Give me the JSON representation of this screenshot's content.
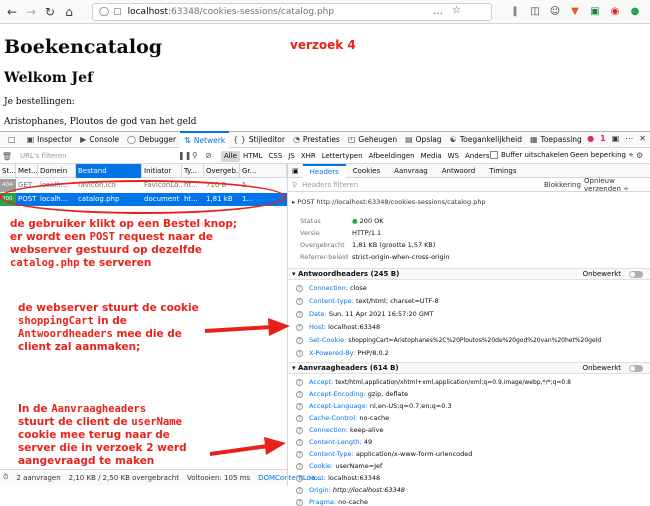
{
  "browser": {
    "url_host": "localhost",
    "url_path": ":63348/cookies-sessions/catalog.php",
    "url_dots": "…",
    "colors": {
      "accent": "#0074e8",
      "annotation": "#e8221b"
    }
  },
  "page": {
    "title": "Boekencatalog",
    "welcome": "Welkom Jef",
    "orders_label": "Je bestellingen:",
    "orders_value": "Aristophanes, Ploutos de god van het geld",
    "verzoek": "verzoek 4"
  },
  "devtools": {
    "tabs": [
      "Inspector",
      "Console",
      "Debugger",
      "Netwerk",
      "Stijleditor",
      "Prestaties",
      "Geheugen",
      "Opslag",
      "Toegankelijkheid",
      "Toepassing"
    ],
    "active_tab": "Netwerk",
    "error_count": "1",
    "filter_placeholder": "URL's filteren",
    "types": [
      "Alle",
      "HTML",
      "CSS",
      "JS",
      "XHR",
      "Lettertypen",
      "Afbeeldingen",
      "Media",
      "WS",
      "Anders"
    ],
    "cache_label": "Buffer uitschakelen",
    "throttle_label": "Geen beperking ÷",
    "columns": [
      "St...",
      "Met...",
      "Domein",
      "Bestand",
      "Initiator",
      "Ty...",
      "Overgeb...",
      "Gr..."
    ],
    "rows": [
      {
        "status": "404",
        "method": "GET",
        "domain": "localh...",
        "file": "favicon.ico",
        "initiator": "FaviconLo...",
        "type": "ht...",
        "transferred": "710 B",
        "size": "5..."
      },
      {
        "status": "200",
        "method": "POST",
        "domain": "localh...",
        "file": "catalog.php",
        "initiator": "document",
        "type": "ht...",
        "transferred": "1,81 kB",
        "size": "1..."
      }
    ],
    "footer": {
      "requests": "2 aanvragen",
      "transferred": "2,10 KB / 2,50 KB overgebracht",
      "finished": "Voltooien: 105 ms",
      "dcl": "DOMContentLoa..."
    }
  },
  "details": {
    "tabs": [
      "Headers",
      "Cookies",
      "Aanvraag",
      "Antwoord",
      "Timings"
    ],
    "active_tab": "Headers",
    "filter_placeholder": "Headers filteren",
    "blocking": "Blokkering",
    "open_again": "Opnieuw verzenden ÷",
    "request_line": "▸ POST http://localhost:63348/cookies-sessions/catalog.php",
    "summary": [
      {
        "k": "Status",
        "v": "200 OK"
      },
      {
        "k": "Versie",
        "v": "HTTP/1.1"
      },
      {
        "k": "Overgebracht",
        "v": "1,81 KB (grootte 1,57 KB)"
      },
      {
        "k": "Referrer-beleid",
        "v": "strict-origin-when-cross-origin"
      }
    ],
    "response_section": "Antwoordheaders (245 B)",
    "request_section": "Aanvraagheaders (614 B)",
    "raw_label": "Onbewerkt",
    "response_headers": [
      {
        "k": "Connection:",
        "v": "close"
      },
      {
        "k": "Content-type:",
        "v": "text/html; charset=UTF-8"
      },
      {
        "k": "Date:",
        "v": "Sun, 11 Apr 2021 16:57:20 GMT"
      },
      {
        "k": "Host:",
        "v": "localhost:63348"
      },
      {
        "k": "Set-Cookie:",
        "v": "shoppingCart=Aristophanes%2C%20Ploutos%20de%20god%20van%20het%20geld"
      },
      {
        "k": "X-Powered-By:",
        "v": "PHP/8.0.2"
      }
    ],
    "request_headers": [
      {
        "k": "Accept:",
        "v": "text/html,application/xhtml+xml,application/xml;q=0.9,image/webp,*/*;q=0.8"
      },
      {
        "k": "Accept-Encoding:",
        "v": "gzip, deflate"
      },
      {
        "k": "Accept-Language:",
        "v": "nl,en-US;q=0.7,en;q=0.3"
      },
      {
        "k": "Cache-Control:",
        "v": "no-cache"
      },
      {
        "k": "Connection:",
        "v": "keep-alive"
      },
      {
        "k": "Content-Length:",
        "v": "49"
      },
      {
        "k": "Content-Type:",
        "v": "application/x-www-form-urlencoded"
      },
      {
        "k": "Cookie:",
        "v": "userName=Jef"
      },
      {
        "k": "Host:",
        "v": "localhost:63348"
      },
      {
        "k": "Origin:",
        "v": "http://localhost:63348"
      },
      {
        "k": "Pragma:",
        "v": "no-cache"
      }
    ]
  },
  "annotations": {
    "a1": [
      "de gebruiker klikt op een Bestel knop;",
      "er wordt een",
      "POST",
      "request naar de",
      "webserver gestuurd op dezelfde",
      "catalog.php",
      "te serveren"
    ],
    "a2": [
      "de webserver stuurt de cookie",
      "shoppingCart",
      "in de",
      "Antwoordheaders",
      "mee die de",
      "client zal aanmaken;"
    ],
    "a3": [
      "In de",
      "Aanvraagheaders",
      "stuurt de client de",
      "userName",
      "cookie mee terug naar de",
      "server die in verzoek 2 werd",
      "aangevraagd te maken"
    ]
  }
}
